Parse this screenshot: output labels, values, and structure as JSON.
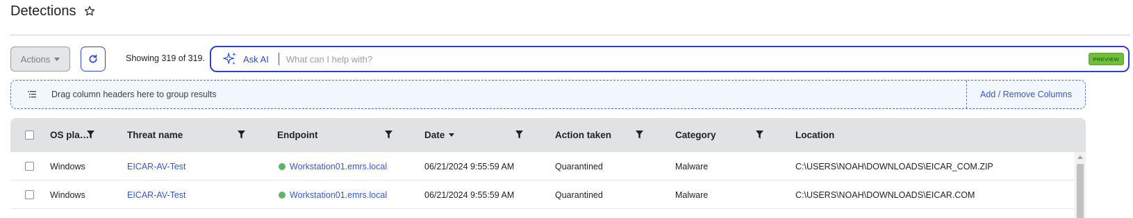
{
  "page": {
    "title": "Detections"
  },
  "toolbar": {
    "actions_label": "Actions",
    "showing_text": "Showing 319 of 319.",
    "ask_ai_label": "Ask AI",
    "ai_placeholder": "What can I help with?",
    "ai_value": "",
    "preview_badge": "PREVIEW"
  },
  "group_bar": {
    "hint": "Drag column headers here to group results",
    "add_remove_label": "Add / Remove Columns"
  },
  "table": {
    "columns": [
      {
        "label": "OS pla…",
        "filterable": true
      },
      {
        "label": "Threat name",
        "filterable": true
      },
      {
        "label": "Endpoint",
        "filterable": true
      },
      {
        "label": "Date",
        "filterable": true,
        "sort": "descending"
      },
      {
        "label": "Action taken",
        "filterable": true
      },
      {
        "label": "Category",
        "filterable": true
      },
      {
        "label": "Location",
        "filterable": false
      }
    ],
    "rows": [
      {
        "os": "Windows",
        "threat": "EICAR-AV-Test",
        "endpoint": "Workstation01.emrs.local",
        "date": "06/21/2024 9:55:59 AM",
        "action": "Quarantined",
        "category": "Malware",
        "location": "C:\\USERS\\NOAH\\DOWNLOADS\\EICAR_COM.ZIP"
      },
      {
        "os": "Windows",
        "threat": "EICAR-AV-Test",
        "endpoint": "Workstation01.emrs.local",
        "date": "06/21/2024 9:55:59 AM",
        "action": "Quarantined",
        "category": "Malware",
        "location": "C:\\USERS\\NOAH\\DOWNLOADS\\EICAR.COM"
      }
    ]
  },
  "icons": {
    "favorite": "star-icon",
    "refresh": "refresh-icon",
    "ai": "sparkle-icon",
    "group": "group-list-icon",
    "filter": "filter-icon",
    "endpoint_status": "online-status-dot"
  },
  "colors": {
    "accent": "#2a4bd6",
    "link": "#3557d4",
    "online": "#5bb565",
    "preview": "#6fbf3d"
  }
}
